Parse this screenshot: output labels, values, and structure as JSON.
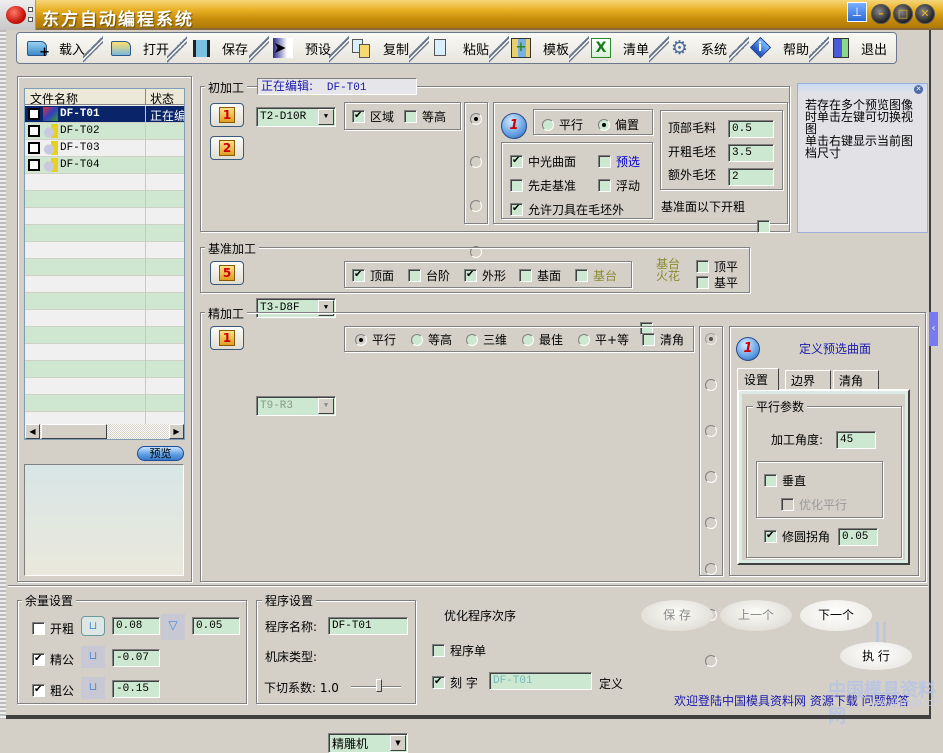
{
  "window": {
    "title": "东方自动编程系统",
    "controls": {
      "pin": "pin-icon",
      "minimize": "minimize-icon",
      "maximize": "maximize-icon",
      "close": "close-icon"
    }
  },
  "toolbar": {
    "items": [
      {
        "label": "载入",
        "icon": "load-folder-icon"
      },
      {
        "label": "打开",
        "icon": "open-folder-icon"
      },
      {
        "label": "保存",
        "icon": "save-disk-icon"
      },
      {
        "label": "预设",
        "icon": "cursor-icon"
      },
      {
        "label": "复制",
        "icon": "copy-icon"
      },
      {
        "label": "粘贴",
        "icon": "paste-icon"
      },
      {
        "label": "模板",
        "icon": "template-icon"
      },
      {
        "label": "清单",
        "icon": "excel-icon"
      },
      {
        "label": "系统",
        "icon": "gear-icon"
      },
      {
        "label": "帮助",
        "icon": "info-icon"
      },
      {
        "label": "退出",
        "icon": "exit-door-icon"
      }
    ]
  },
  "file_list": {
    "columns": [
      "文件名称",
      "状态"
    ],
    "rows": [
      {
        "name": "DF-T01",
        "status": "正在编",
        "checked": false,
        "selected": true
      },
      {
        "name": "DF-T02",
        "status": "",
        "checked": false,
        "selected": false
      },
      {
        "name": "DF-T03",
        "status": "",
        "checked": false,
        "selected": false
      },
      {
        "name": "DF-T04",
        "status": "",
        "checked": false,
        "selected": false
      }
    ],
    "preview_button": "预览"
  },
  "rough": {
    "legend": "初加工",
    "editing_label": "正在编辑:",
    "editing_value": "DF-T01",
    "tools": [
      "1",
      "2"
    ],
    "tool_combo": "T2-D10R",
    "region": {
      "label": "区域",
      "checked": true
    },
    "contour": {
      "label": "等高",
      "checked": false
    },
    "mode_radios": [
      true,
      false,
      false,
      false
    ],
    "badge": "1",
    "parallel": {
      "label": "平行",
      "selected": false
    },
    "offset": {
      "label": "偏置",
      "selected": true
    },
    "options": [
      {
        "label": "中光曲面",
        "checked": true
      },
      {
        "label": "预选",
        "checked": false,
        "color": "#0000cc"
      },
      {
        "label": "先走基准",
        "checked": false
      },
      {
        "label": "浮动",
        "checked": false
      },
      {
        "label": "允许刀具在毛坯外",
        "checked": true
      }
    ],
    "params": [
      {
        "label": "顶部毛料",
        "value": "0.5"
      },
      {
        "label": "开粗毛坯",
        "value": "3.5"
      },
      {
        "label": "额外毛坯",
        "value": "2"
      }
    ],
    "below_base": {
      "label": "基准面以下开粗",
      "checked": false
    }
  },
  "tip": {
    "text": "若存在多个预览图像时单击左键可切换视图\n单击右键显示当前图档尺寸",
    "close_icon": "close-circle-icon"
  },
  "base": {
    "legend": "基准加工",
    "tool": "5",
    "tool_combo": "T3-D8F",
    "options": [
      {
        "label": "顶面",
        "checked": true
      },
      {
        "label": "台阶",
        "checked": false
      },
      {
        "label": "外形",
        "checked": true
      },
      {
        "label": "基面",
        "checked": false
      },
      {
        "label": "基台",
        "checked": false,
        "color": "#8a8a30"
      }
    ],
    "flower": {
      "label_top": "基台",
      "label_bottom": "火花",
      "checked": false,
      "color": "#8a8a30"
    },
    "top_flat": {
      "label": "顶平",
      "checked": false
    },
    "base_flat": {
      "label": "基平",
      "checked": false
    }
  },
  "finish": {
    "legend": "精加工",
    "tool": "1",
    "tool_combo": "T9-R3",
    "strategies": [
      {
        "label": "平行",
        "selected": true
      },
      {
        "label": "等高",
        "selected": false
      },
      {
        "label": "三维",
        "selected": false
      },
      {
        "label": "最佳",
        "selected": false
      },
      {
        "label": "平+等",
        "selected": false
      }
    ],
    "clean_corner": {
      "label": "清角",
      "checked": false
    },
    "mode_radios": [
      true,
      false,
      false,
      false,
      false,
      false,
      false,
      false
    ],
    "define_surface": "定义预选曲面",
    "badge": "1",
    "tabs": [
      "设置",
      "边界",
      "清角"
    ],
    "active_tab": 0,
    "parallel_group": "平行参数",
    "angle_label": "加工角度:",
    "angle_value": "45",
    "vertical": {
      "label": "垂直",
      "checked": false
    },
    "optimize_parallel": {
      "label": "优化平行",
      "checked": false,
      "disabled": true
    },
    "round_corner": {
      "label": "修圆拐角",
      "checked": true,
      "value": "0.05"
    }
  },
  "allowance": {
    "legend": "余量设置",
    "rows": [
      {
        "label": "开粗",
        "checked": false,
        "value": "0.08",
        "value2": "0.05"
      },
      {
        "label": "精公",
        "checked": true,
        "value": "-0.07"
      },
      {
        "label": "粗公",
        "checked": true,
        "value": "-0.15"
      }
    ]
  },
  "program": {
    "legend": "程序设置",
    "name_label": "程序名称:",
    "name_value": "DF-T01",
    "machine_label": "机床类型:",
    "machine_value": "精雕机",
    "cut_label": "下切系数: 1.0",
    "cut_slider": 0.55
  },
  "optimize": {
    "title": "优化程序次序",
    "program_sheet": {
      "label": "程序单",
      "checked": false
    },
    "engrave": {
      "label": "刻 字",
      "checked": true,
      "value": "DF-T01"
    },
    "define": "定义"
  },
  "buttons": {
    "save": "保 存",
    "prev": "上一个",
    "next": "下一个",
    "run": "执 行"
  },
  "footer": {
    "link": "欢迎登陆中国模具资料网 资源下载 问题解答",
    "watermark": "中国模具资料网",
    "watermark_url": "www.mjzl.cn"
  }
}
